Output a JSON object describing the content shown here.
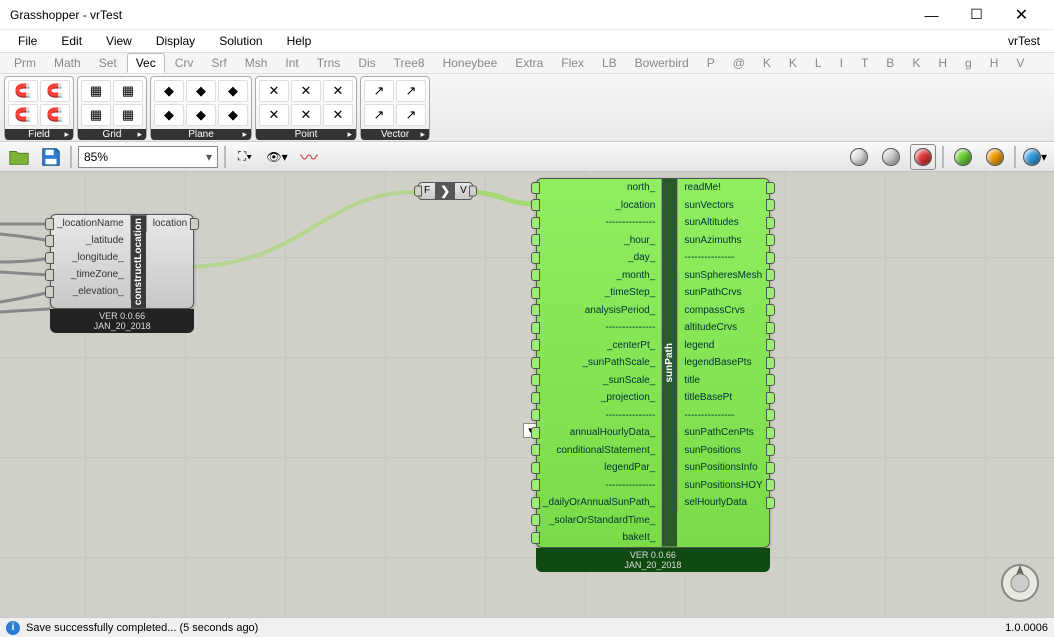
{
  "window": {
    "title": "Grasshopper - vrTest",
    "tag": "vrTest"
  },
  "menu": [
    "File",
    "Edit",
    "View",
    "Display",
    "Solution",
    "Help"
  ],
  "tabs": [
    "Prm",
    "Math",
    "Set",
    "Vec",
    "Crv",
    "Srf",
    "Msh",
    "Int",
    "Trns",
    "Dis",
    "Tree8",
    "Honeybee",
    "Extra",
    "Flex",
    "LB",
    "Bowerbird",
    "P",
    "@",
    "K",
    "K",
    "L",
    "I",
    "T",
    "B",
    "K",
    "H",
    "g",
    "H",
    "V"
  ],
  "active_tab": "Vec",
  "ribbon_groups": [
    "Field",
    "Grid",
    "Plane",
    "Point",
    "Vector"
  ],
  "toolbar": {
    "zoom": "85%"
  },
  "node1": {
    "name": "constructLocation",
    "inputs": [
      "_locationName",
      "_latitude",
      "_longitude_",
      "_timeZone_",
      "_elevation_"
    ],
    "outputs": [
      "location"
    ],
    "version": "VER 0.0.66",
    "date": "JAN_20_2018"
  },
  "node2": {
    "name": "sunPath",
    "inputs": [
      "north_",
      "_location",
      "---------------",
      "_hour_",
      "_day_",
      "_month_",
      "_timeStep_",
      "analysisPeriod_",
      "---------------",
      "_centerPt_",
      "_sunPathScale_",
      "_sunScale_",
      "_projection_",
      "---------------",
      "annualHourlyData_",
      "conditionalStatement_",
      "legendPar_",
      "---------------",
      "_dailyOrAnnualSunPath_",
      "_solarOrStandardTime_",
      "bakeIt_"
    ],
    "outputs": [
      "readMe!",
      "sunVectors",
      "sunAltitudes",
      "sunAzimuths",
      "---------------",
      "sunSpheresMesh",
      "sunPathCrvs",
      "compassCrvs",
      "altitudeCrvs",
      "legend",
      "legendBasePts",
      "title",
      "titleBasePt",
      "---------------",
      "sunPathCenPts",
      "sunPositions",
      "sunPositionsInfo",
      "sunPositionsHOY",
      "selHourlyData"
    ],
    "version": "VER 0.0.66",
    "date": "JAN_20_2018"
  },
  "node_mini": {
    "in": "F",
    "label": "❯",
    "out": "V"
  },
  "statusbar": {
    "message": "Save successfully completed... (5 seconds ago)",
    "version": "1.0.0006"
  },
  "chart_data": null
}
